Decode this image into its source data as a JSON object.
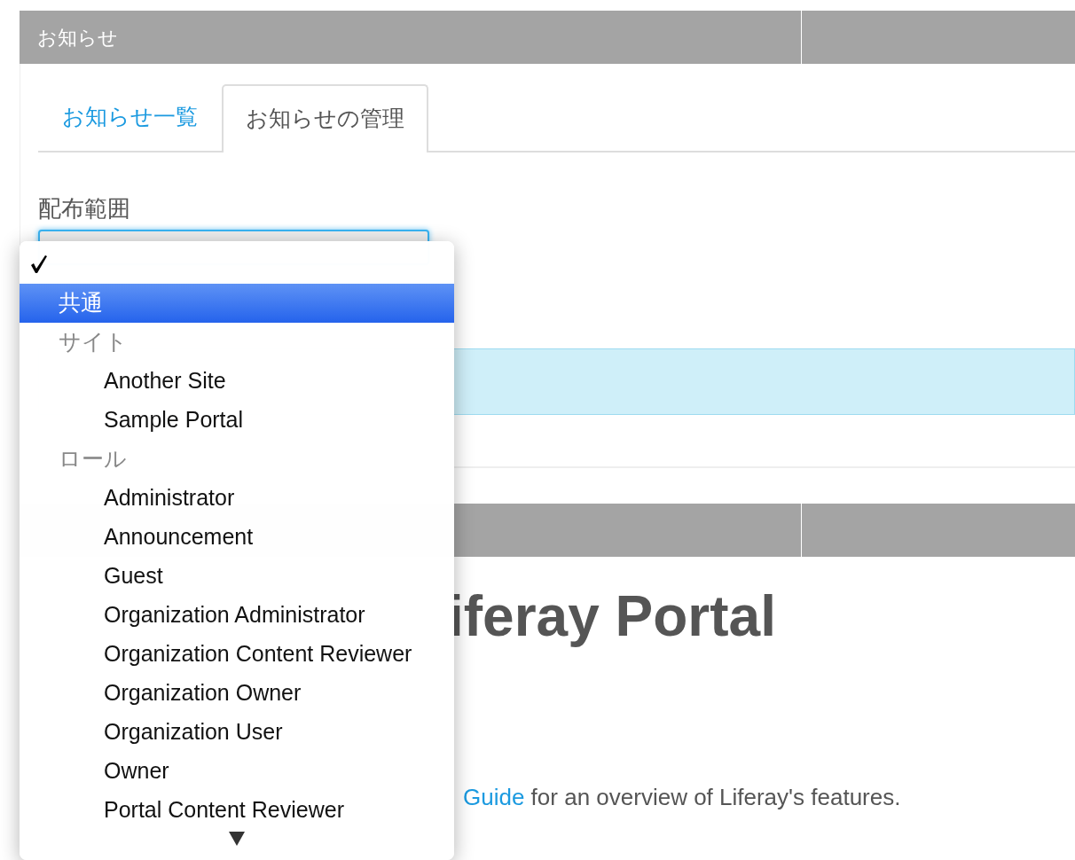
{
  "announcements": {
    "title": "お知らせ",
    "tabs": [
      {
        "label": "お知らせ一覧",
        "selected": false
      },
      {
        "label": "お知らせの管理",
        "selected": true
      }
    ],
    "field_label": "配布範囲",
    "select": {
      "focused": true,
      "open": true
    },
    "menu": {
      "options": [
        {
          "kind": "option",
          "checked": true,
          "highlighted": false
        },
        {
          "kind": "option",
          "label": "共通",
          "checked": false,
          "highlighted": true
        },
        {
          "kind": "group",
          "label": "サイト",
          "children": [
            {
              "kind": "option",
              "label": "Another Site",
              "checked": false,
              "highlighted": false
            },
            {
              "kind": "option",
              "label": "Sample Portal",
              "checked": false,
              "highlighted": false
            }
          ]
        },
        {
          "kind": "group",
          "label": "ロール",
          "children": [
            {
              "kind": "option",
              "label": "Administrator",
              "checked": false,
              "highlighted": false
            },
            {
              "kind": "option",
              "label": "Announcement",
              "checked": false,
              "highlighted": false
            },
            {
              "kind": "option",
              "label": "Guest",
              "checked": false,
              "highlighted": false
            },
            {
              "kind": "option",
              "label": "Organization Administrator",
              "checked": false,
              "highlighted": false
            },
            {
              "kind": "option",
              "label": "Organization Content Reviewer",
              "checked": false,
              "highlighted": false
            },
            {
              "kind": "option",
              "label": "Organization Owner",
              "checked": false,
              "highlighted": false
            },
            {
              "kind": "option",
              "label": "Organization User",
              "checked": false,
              "highlighted": false
            },
            {
              "kind": "option",
              "label": "Owner",
              "checked": false,
              "highlighted": false
            },
            {
              "kind": "option",
              "label": "Portal Content Reviewer",
              "checked": false,
              "highlighted": false
            }
          ]
        }
      ],
      "more_below": true
    }
  },
  "welcome": {
    "heading": "iferay Portal",
    "link": "Guide",
    "text": " for an overview of Liferay's features."
  }
}
